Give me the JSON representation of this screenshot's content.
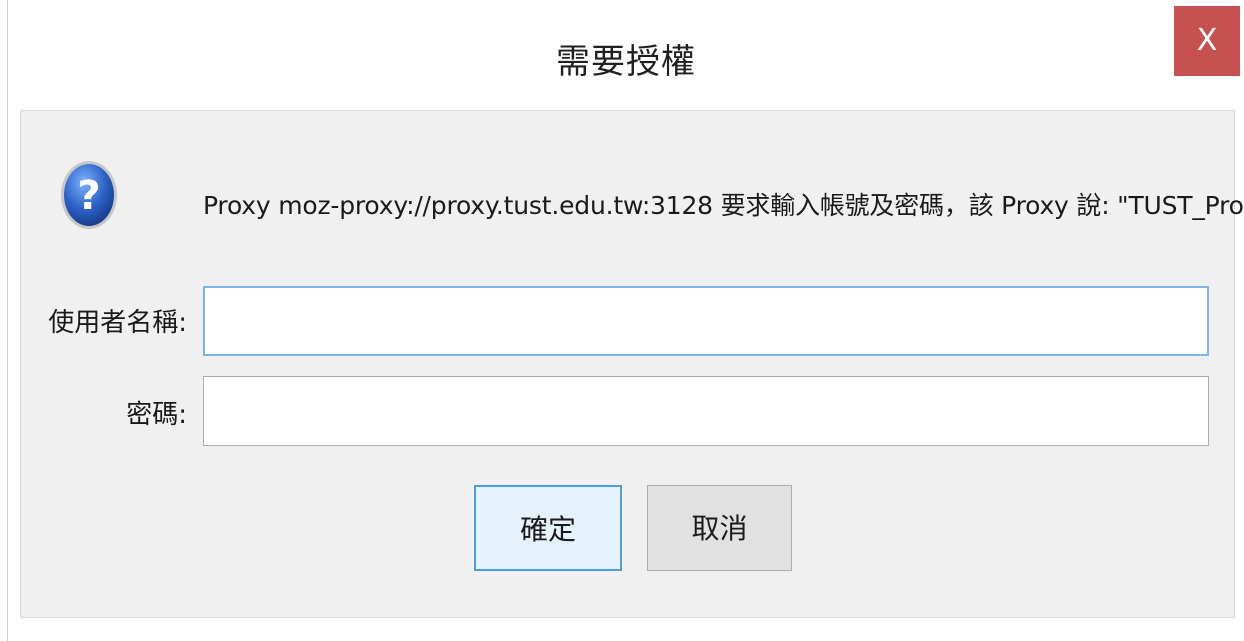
{
  "dialog": {
    "title": "需要授權",
    "close_label": "X",
    "message": "Proxy moz-proxy://proxy.tust.edu.tw:3128 要求輸入帳號及密碼，該 Proxy 說: \"TUST_Proxy\"",
    "icon": "question-icon",
    "accent_color": "#c75050"
  },
  "form": {
    "username_label": "使用者名稱:",
    "username_value": "",
    "password_label": "密碼:",
    "password_value": ""
  },
  "buttons": {
    "ok_label": "確定",
    "cancel_label": "取消"
  }
}
